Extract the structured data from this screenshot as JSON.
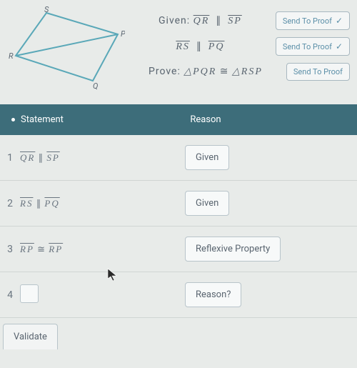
{
  "diagram": {
    "vertices": {
      "S": "S",
      "P": "P",
      "R": "R",
      "Q": "Q"
    }
  },
  "givens": [
    {
      "label_prefix": "Given:",
      "left": "QR",
      "symbol": "∥",
      "right": "SP",
      "button": "Send To Proof",
      "checked": true
    },
    {
      "label_prefix": "",
      "left": "RS",
      "symbol": "∥",
      "right": "PQ",
      "button": "Send To Proof",
      "checked": true
    }
  ],
  "prove": {
    "label_prefix": "Prove:",
    "left": "△PQR",
    "symbol": "≅",
    "right": "△RSP",
    "button": "Send To Proof",
    "checked": false
  },
  "table": {
    "header_stmt": "Statement",
    "header_reason": "Reason"
  },
  "rows": [
    {
      "n": "1",
      "left": "QR",
      "sym": "∥",
      "right": "SP",
      "reason": "Given"
    },
    {
      "n": "2",
      "left": "RS",
      "sym": "∥",
      "right": "PQ",
      "reason": "Given"
    },
    {
      "n": "3",
      "left": "RP",
      "sym": "≅",
      "right": "RP",
      "reason": "Reflexive Property"
    },
    {
      "n": "4",
      "left": "",
      "sym": "",
      "right": "",
      "reason": "Reason?"
    }
  ],
  "validate": "Validate"
}
